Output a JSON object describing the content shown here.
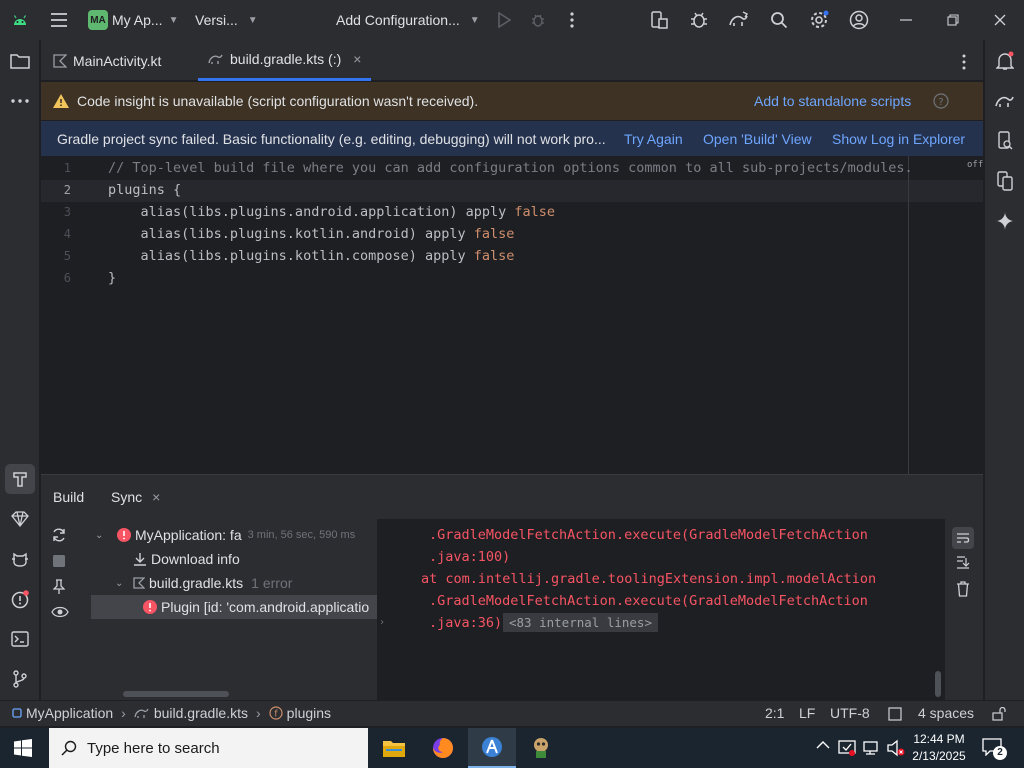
{
  "titlebar": {
    "project_badge": "MA",
    "project_name": "My Ap...",
    "vcs_label": "Versi...",
    "run_config": "Add Configuration..."
  },
  "tabs": [
    {
      "label": "MainActivity.kt"
    },
    {
      "label": "build.gradle.kts (:)"
    }
  ],
  "banner_insight": {
    "message": "Code insight is unavailable (script configuration wasn't received).",
    "action": "Add to standalone scripts"
  },
  "banner_sync": {
    "message": "Gradle project sync failed. Basic functionality (e.g. editing, debugging) will not work pro...",
    "try_again": "Try Again",
    "open_build": "Open 'Build' View",
    "show_log": "Show Log in Explorer"
  },
  "editor": {
    "off_label": "off",
    "lines": [
      {
        "num": "1",
        "text": "// Top-level build file where you can add configuration options common to all sub-projects/modules."
      },
      {
        "num": "2",
        "text": "plugins {"
      },
      {
        "num": "3",
        "prefix": "    alias(libs.plugins.android.application) apply ",
        "kw": "false"
      },
      {
        "num": "4",
        "prefix": "    alias(libs.plugins.kotlin.android) apply ",
        "kw": "false"
      },
      {
        "num": "5",
        "prefix": "    alias(libs.plugins.kotlin.compose) apply ",
        "kw": "false"
      },
      {
        "num": "6",
        "text": "}"
      }
    ]
  },
  "bottom_panel": {
    "tabs": [
      {
        "label": "Build"
      },
      {
        "label": "Sync"
      }
    ],
    "tree": {
      "root_label": "MyApplication: fa",
      "root_time": "3 min, 56 sec, 590 ms",
      "download_info": "Download info",
      "file_label": "build.gradle.kts",
      "file_errors": "1 error",
      "plugin_error": "Plugin [id: 'com.android.applicatio"
    },
    "console": [
      ".GradleModelFetchAction.execute(GradleModelFetchAction",
      ".java:100)",
      "at com.intellij.gradle.toolingExtension.impl.modelAction",
      ".GradleModelFetchAction.execute(GradleModelFetchAction",
      ".java:36)"
    ],
    "internal_lines": "<83 internal lines>"
  },
  "statusbar": {
    "project": "MyApplication",
    "file": "build.gradle.kts",
    "symbol": "plugins",
    "position": "2:1",
    "line_sep": "LF",
    "encoding": "UTF-8",
    "indent": "4 spaces"
  },
  "taskbar": {
    "search_placeholder": "Type here to search",
    "time": "12:44 PM",
    "date": "2/13/2025",
    "notifications": "2"
  },
  "colors": {
    "accent": "#3574f0",
    "error": "#f75464",
    "link": "#6ea6ff",
    "warning_bg": "#3d3223",
    "sync_bg": "#25324d"
  }
}
